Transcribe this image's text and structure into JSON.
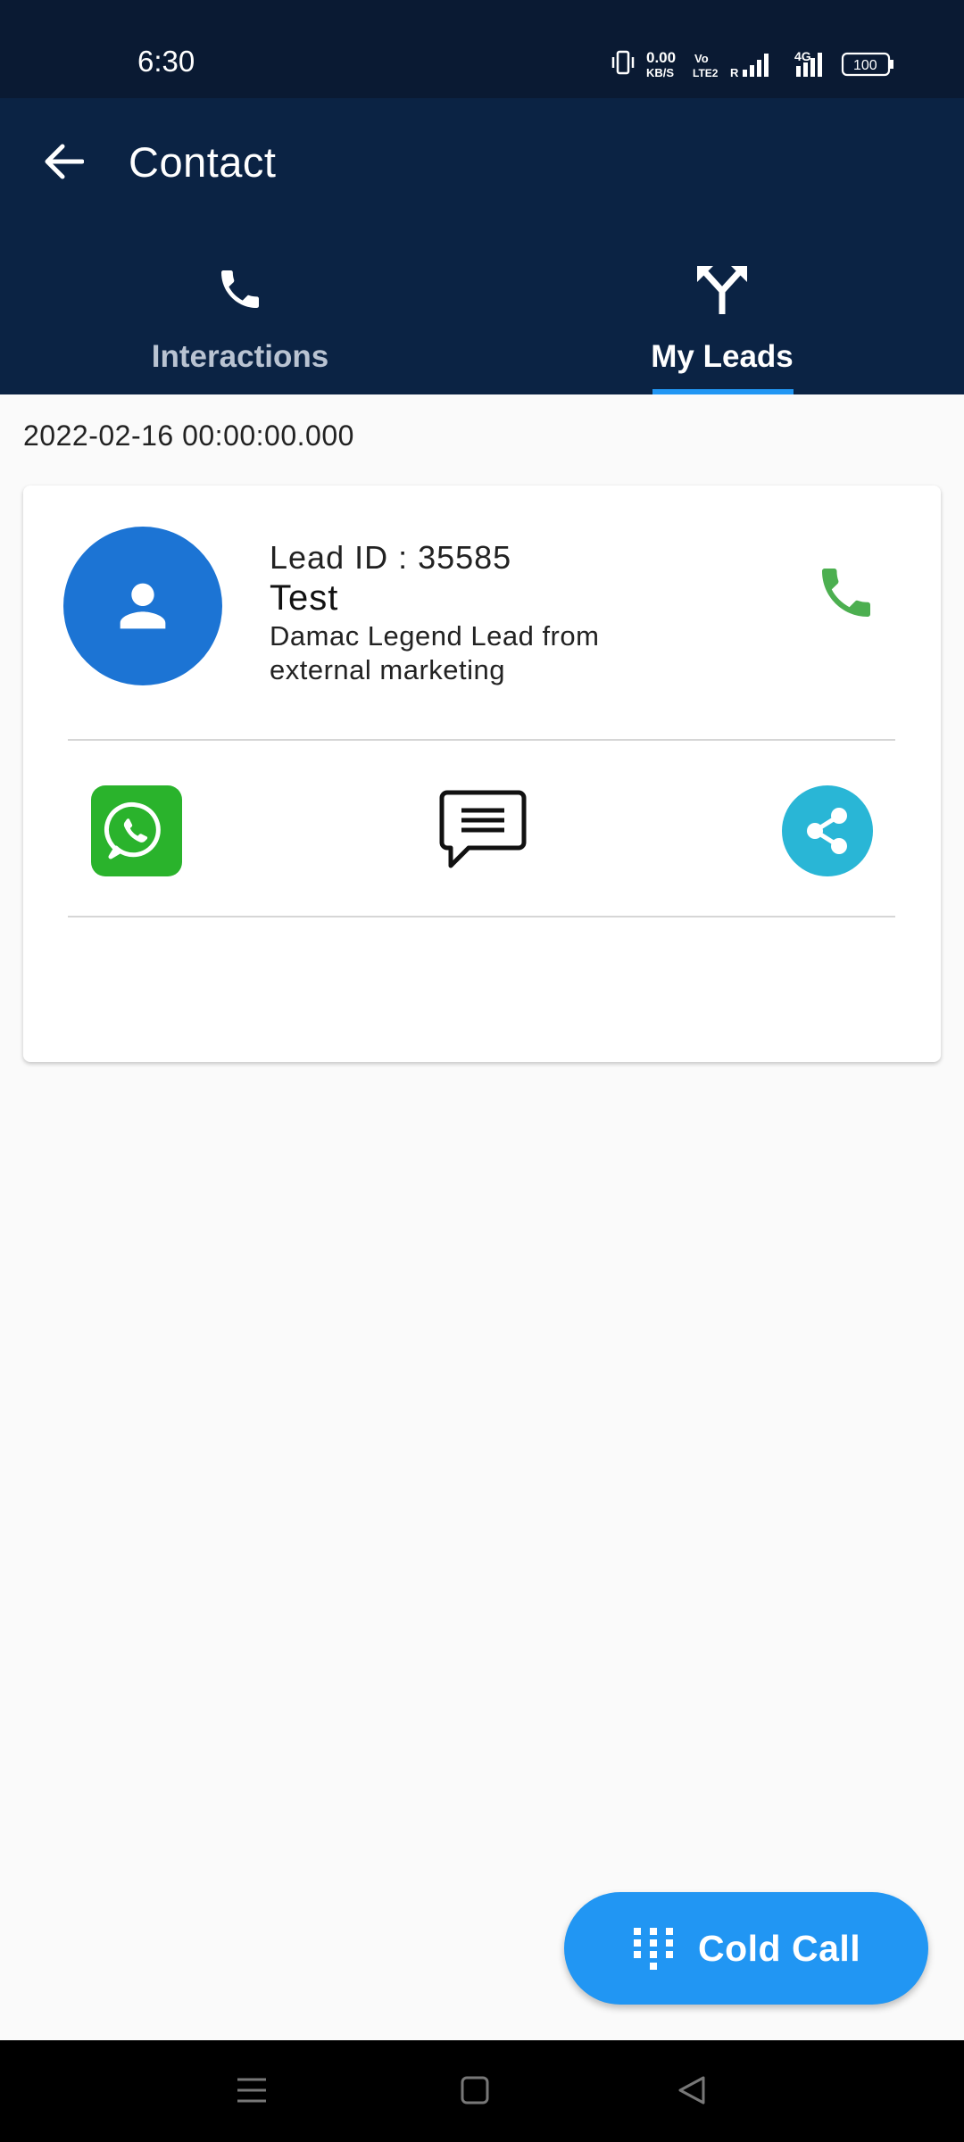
{
  "status_bar": {
    "time": "6:30",
    "net_speed_value": "0.00",
    "net_speed_unit": "KB/S",
    "volte_top": "Vo",
    "volte_bottom": "LTE2",
    "roaming": "R",
    "network_type": "4G",
    "battery": "100"
  },
  "app_bar": {
    "title": "Contact",
    "back_icon": "arrow-left-icon"
  },
  "tabs": [
    {
      "label": "Interactions",
      "icon": "phone-icon",
      "selected": false
    },
    {
      "label": "My Leads",
      "icon": "merge-arrow-icon",
      "selected": true
    }
  ],
  "content": {
    "date": "2022-02-16 00:00:00.000",
    "lead": {
      "id_label": "Lead ID : 35585",
      "name": "Test",
      "description": "Damac Legend Lead from external marketing"
    }
  },
  "actions": {
    "call_icon": "phone-icon",
    "whatsapp_icon": "whatsapp-icon",
    "sms_icon": "message-icon",
    "share_icon": "share-icon"
  },
  "fab": {
    "label": "Cold Call",
    "icon": "dialpad-icon"
  },
  "colors": {
    "status_bar": "#0a1a33",
    "app_bar": "#0b2344",
    "accent": "#2196f3",
    "avatar": "#1c74d4",
    "call_green": "#4caf50",
    "whatsapp": "#2ab32c",
    "share": "#29b6d6"
  }
}
